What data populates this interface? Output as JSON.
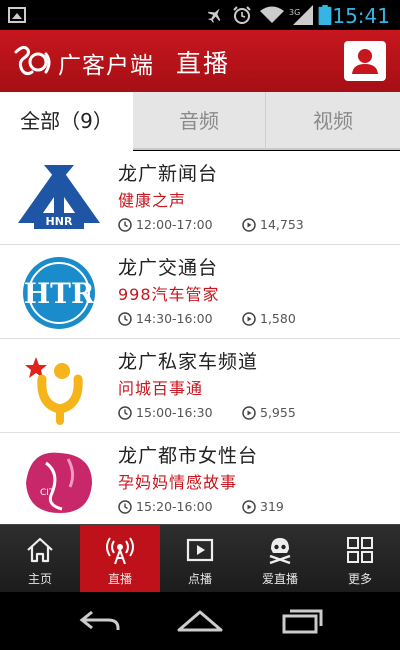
{
  "status_bar": {
    "icons": [
      "picture-icon",
      "airplane-mode-icon",
      "alarm-icon",
      "wifi-icon",
      "signal-icon",
      "battery-icon"
    ],
    "time": "15:41",
    "time_color": "#35b5e5"
  },
  "header": {
    "logo_icon": "logo-icon",
    "app_name": "广客户端",
    "page_title": "直播",
    "user_icon": "user-icon",
    "brand_color": "#c8161e"
  },
  "tabs": [
    {
      "label": "全部（9）",
      "active": true
    },
    {
      "label": "音频",
      "active": false
    },
    {
      "label": "视频",
      "active": false
    }
  ],
  "stations": [
    {
      "name": "龙广新闻台",
      "program": "健康之声",
      "time": "12:00-17:00",
      "plays": "14,753",
      "logo": "hnr-logo-icon"
    },
    {
      "name": "龙广交通台",
      "program": "998汽车管家",
      "time": "14:30-16:00",
      "plays": "1,580",
      "logo": "htr-logo-icon"
    },
    {
      "name": "龙广私家车频道",
      "program": "问城百事通",
      "time": "15:00-16:30",
      "plays": "5,955",
      "logo": "star-person-logo-icon"
    },
    {
      "name": "龙广都市女性台",
      "program": "孕妈妈情感故事",
      "time": "15:20-16:00",
      "plays": "319",
      "logo": "cit-logo-icon"
    }
  ],
  "bottom_nav": [
    {
      "label": "主页",
      "icon": "home-icon",
      "active": false
    },
    {
      "label": "直播",
      "icon": "broadcast-icon",
      "active": true
    },
    {
      "label": "点播",
      "icon": "play-icon",
      "active": false
    },
    {
      "label": "爱直播",
      "icon": "pirate-icon",
      "active": false
    },
    {
      "label": "更多",
      "icon": "grid-icon",
      "active": false
    }
  ],
  "system_nav": [
    "back-icon",
    "home-outline-icon",
    "recents-icon"
  ],
  "colors": {
    "accent_red": "#c8161e",
    "nav_active": "#bf1119"
  }
}
